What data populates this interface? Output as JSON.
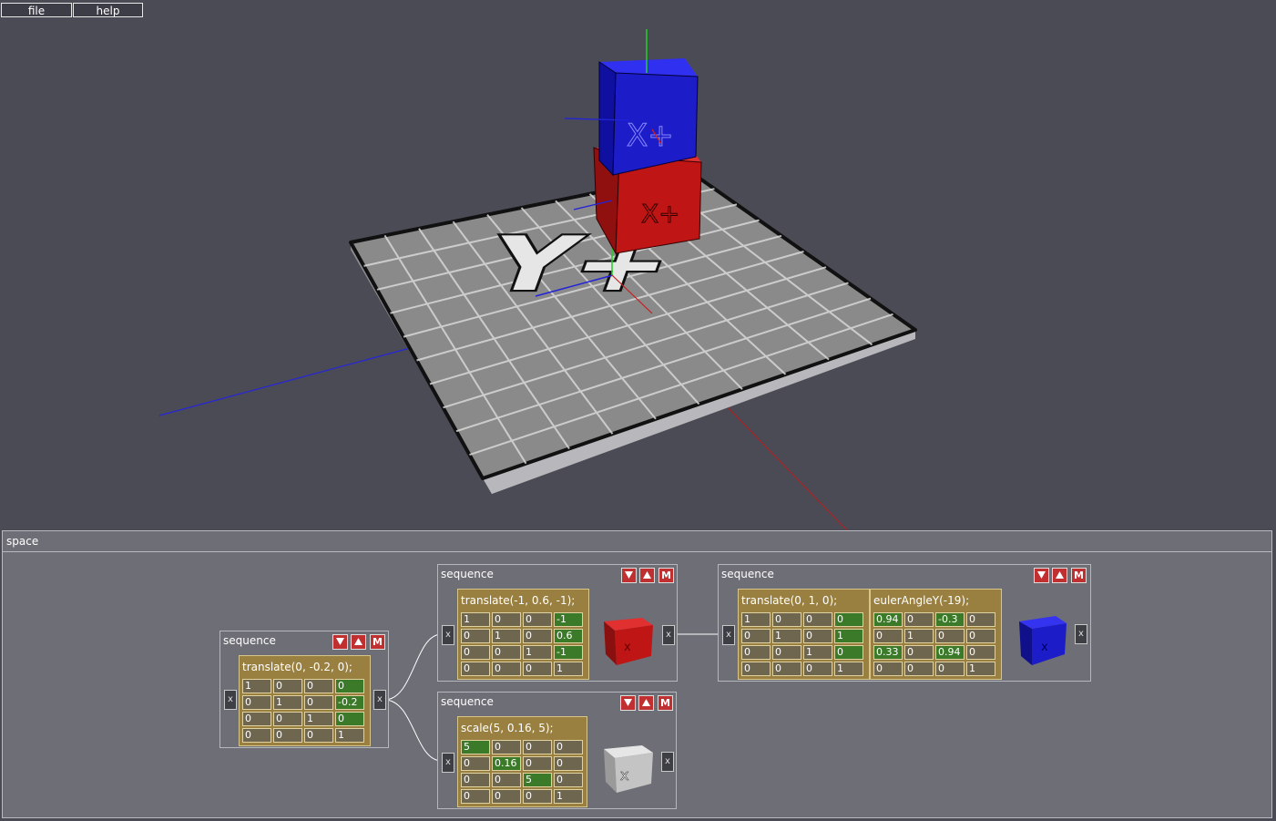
{
  "menu": {
    "file": "file",
    "help": "help"
  },
  "panel": {
    "title": "space"
  },
  "icons": {
    "down": "arrow-down-icon",
    "up": "arrow-up-icon",
    "port": "x-port-icon"
  },
  "scene": {
    "floor_label": "Y+",
    "cube_label": "X+",
    "colors": {
      "background": "#4b4b56",
      "x_axis": "#d02020",
      "y_axis": "#20d020",
      "z_axis": "#2020d0",
      "red_cube": "#c01515",
      "blue_cube": "#1c1cc8"
    }
  },
  "nodes": [
    {
      "title": "sequence",
      "btn_m": "M",
      "port_x": "x",
      "transforms": [
        {
          "label": "translate(0, -0.2, 0);",
          "cells": [
            [
              "1",
              "0",
              "0",
              "0"
            ],
            [
              "0",
              "1",
              "0",
              "-0.2"
            ],
            [
              "0",
              "0",
              "1",
              "0"
            ],
            [
              "0",
              "0",
              "0",
              "1"
            ]
          ]
        }
      ]
    },
    {
      "title": "sequence",
      "btn_m": "M",
      "port_x": "x",
      "transforms": [
        {
          "label": "translate(-1, 0.6, -1);",
          "cells": [
            [
              "1",
              "0",
              "0",
              "-1"
            ],
            [
              "0",
              "1",
              "0",
              "0.6"
            ],
            [
              "0",
              "0",
              "1",
              "-1"
            ],
            [
              "0",
              "0",
              "0",
              "1"
            ]
          ]
        }
      ],
      "preview": "red-cube"
    },
    {
      "title": "sequence",
      "btn_m": "M",
      "port_x": "x",
      "transforms": [
        {
          "label": "scale(5, 0.16, 5);",
          "cells": [
            [
              "5",
              "0",
              "0",
              "0"
            ],
            [
              "0",
              "0.16",
              "0",
              "0"
            ],
            [
              "0",
              "0",
              "5",
              "0"
            ],
            [
              "0",
              "0",
              "0",
              "1"
            ]
          ]
        }
      ],
      "preview": "grey-cube"
    },
    {
      "title": "sequence",
      "btn_m": "M",
      "port_x": "x",
      "transforms": [
        {
          "label": "translate(0, 1, 0);",
          "cells": [
            [
              "1",
              "0",
              "0",
              "0"
            ],
            [
              "0",
              "1",
              "0",
              "1"
            ],
            [
              "0",
              "0",
              "1",
              "0"
            ],
            [
              "0",
              "0",
              "0",
              "1"
            ]
          ]
        },
        {
          "label": "eulerAngleY(-19);",
          "cells": [
            [
              "0.94",
              "0",
              "-0.3",
              "0"
            ],
            [
              "0",
              "1",
              "0",
              "0"
            ],
            [
              "0.33",
              "0",
              "0.94",
              "0"
            ],
            [
              "0",
              "0",
              "0",
              "1"
            ]
          ]
        }
      ],
      "preview": "blue-cube"
    }
  ]
}
